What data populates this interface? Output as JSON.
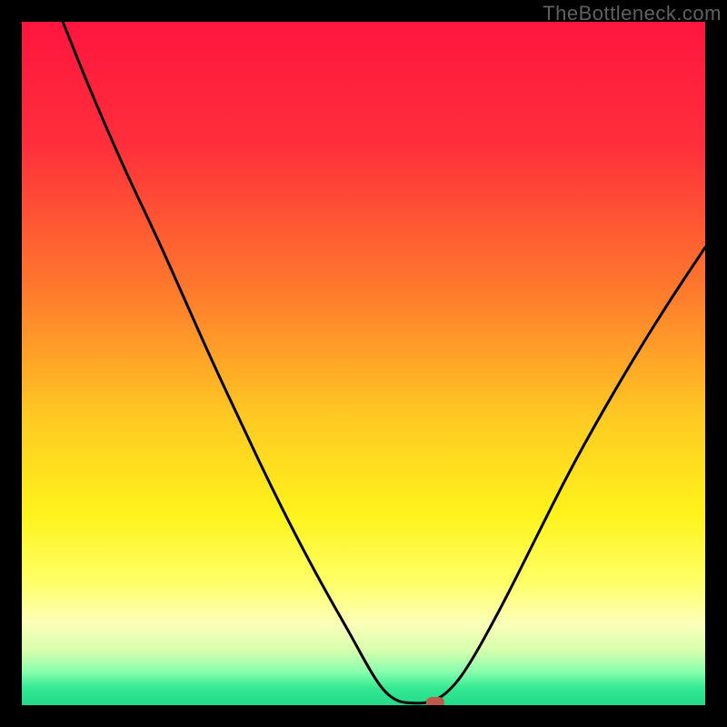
{
  "watermark": "TheBottleneck.com",
  "chart_data": {
    "type": "line",
    "title": "",
    "xlabel": "",
    "ylabel": "",
    "xlim": [
      0,
      100
    ],
    "ylim": [
      0,
      100
    ],
    "gradient_stops": [
      {
        "offset": 0,
        "color": "#ff153f"
      },
      {
        "offset": 18,
        "color": "#ff2f3b"
      },
      {
        "offset": 40,
        "color": "#ff7c2c"
      },
      {
        "offset": 58,
        "color": "#ffca23"
      },
      {
        "offset": 72,
        "color": "#fff31b"
      },
      {
        "offset": 82,
        "color": "#ffff67"
      },
      {
        "offset": 88,
        "color": "#fcffb8"
      },
      {
        "offset": 92,
        "color": "#d6ffad"
      },
      {
        "offset": 95,
        "color": "#8bffae"
      },
      {
        "offset": 97.5,
        "color": "#35e993"
      },
      {
        "offset": 100,
        "color": "#23da88"
      }
    ],
    "curve_points": [
      {
        "x": 6.0,
        "y": 100.0
      },
      {
        "x": 10.0,
        "y": 90.0
      },
      {
        "x": 15.0,
        "y": 78.5
      },
      {
        "x": 20.0,
        "y": 68.0
      },
      {
        "x": 24.0,
        "y": 59.0
      },
      {
        "x": 28.0,
        "y": 50.0
      },
      {
        "x": 32.0,
        "y": 41.5
      },
      {
        "x": 36.0,
        "y": 33.0
      },
      {
        "x": 40.0,
        "y": 25.0
      },
      {
        "x": 44.0,
        "y": 17.5
      },
      {
        "x": 48.0,
        "y": 10.5
      },
      {
        "x": 51.0,
        "y": 5.0
      },
      {
        "x": 53.0,
        "y": 2.0
      },
      {
        "x": 55.0,
        "y": 0.5
      },
      {
        "x": 57.0,
        "y": 0.3
      },
      {
        "x": 59.5,
        "y": 0.3
      },
      {
        "x": 62.0,
        "y": 1.5
      },
      {
        "x": 65.0,
        "y": 5.0
      },
      {
        "x": 70.0,
        "y": 14.0
      },
      {
        "x": 75.0,
        "y": 24.0
      },
      {
        "x": 80.0,
        "y": 34.0
      },
      {
        "x": 85.0,
        "y": 43.0
      },
      {
        "x": 90.0,
        "y": 51.5
      },
      {
        "x": 95.0,
        "y": 59.5
      },
      {
        "x": 100.0,
        "y": 67.0
      }
    ],
    "marker": {
      "x": 60.5,
      "y": 0.4,
      "color": "#bb5a4a"
    }
  }
}
